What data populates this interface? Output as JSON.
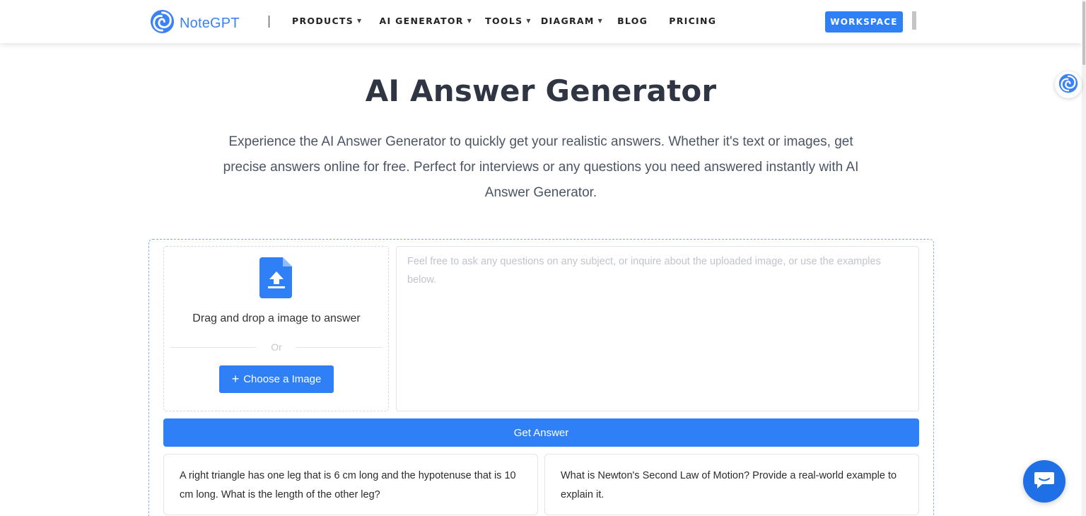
{
  "header": {
    "logo_text": "NoteGPT",
    "nav": [
      {
        "label": "PRODUCTS",
        "has_dropdown": true
      },
      {
        "label": "AI GENERATOR",
        "has_dropdown": true
      },
      {
        "label": "TOOLS",
        "has_dropdown": true
      },
      {
        "label": "DIAGRAM",
        "has_dropdown": true
      },
      {
        "label": "BLOG",
        "has_dropdown": false
      },
      {
        "label": "PRICING",
        "has_dropdown": false
      }
    ],
    "workspace_label": "WORKSPACE"
  },
  "hero": {
    "title": "AI Answer Generator",
    "subtitle": "Experience the AI Answer Generator to quickly get your realistic answers. Whether it's text or images, get precise answers online for free. Perfect for interviews or any questions you need answered instantly with AI Answer Generator."
  },
  "upload": {
    "drag_text": "Drag and drop a image to answer",
    "or_text": "Or",
    "choose_button": "Choose a Image"
  },
  "question": {
    "placeholder": "Feel free to ask any questions on any subject, or inquire about the uploaded image, or use the examples below.",
    "value": ""
  },
  "get_answer_button": "Get Answer",
  "examples": [
    "A right triangle has one leg that is 6 cm long and the hypotenuse that is 10 cm long. What is the length of the other leg?",
    "What is Newton's Second Law of Motion? Provide a real-world example to explain it."
  ],
  "colors": {
    "accent": "#2f80f6",
    "title": "#2f3542",
    "chat_button": "#1f6fe6"
  },
  "icons": [
    "logo-icon",
    "upload-file-icon",
    "chat-icon",
    "plus-icon",
    "caret-down-icon"
  ]
}
